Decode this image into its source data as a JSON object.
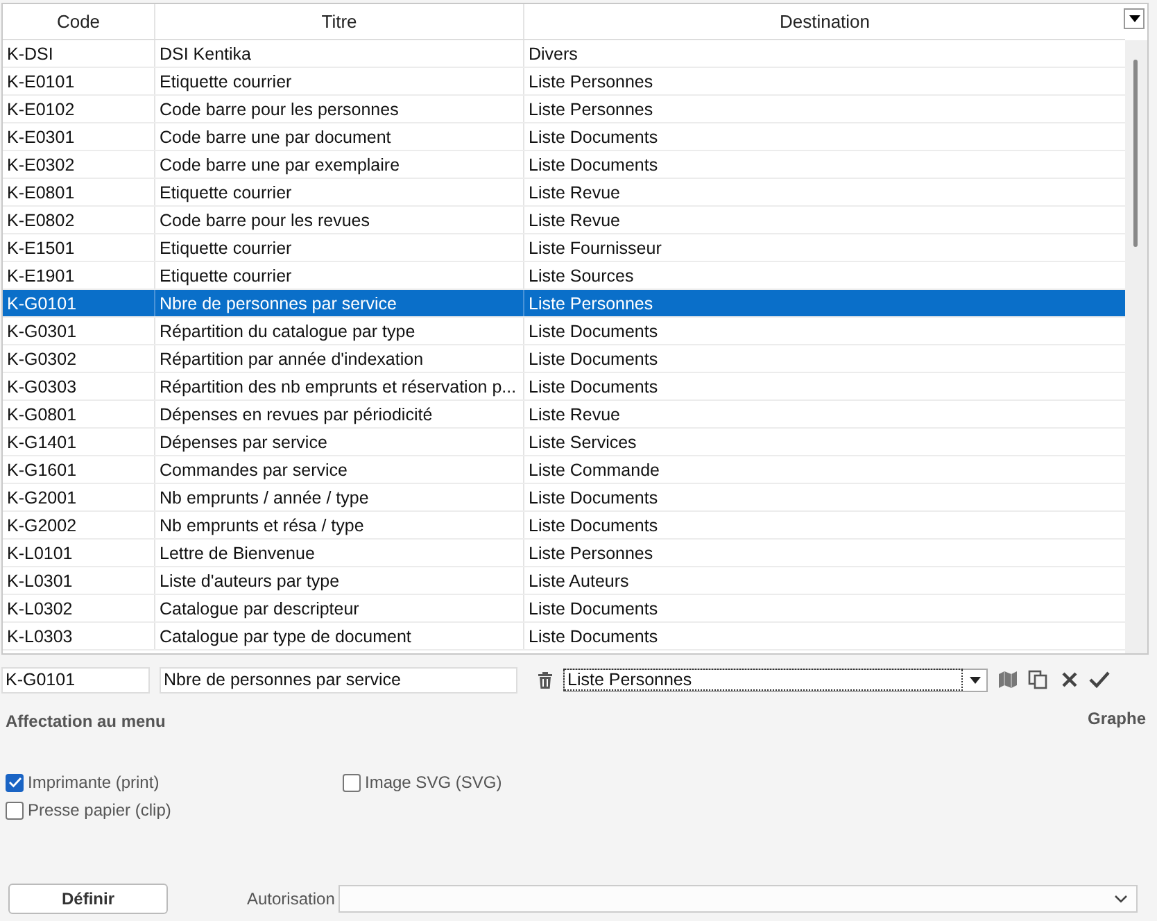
{
  "table": {
    "columns": [
      "Code",
      "Titre",
      "Destination"
    ],
    "rows": [
      {
        "cells": [
          "K-DSI",
          "DSI Kentika",
          "Divers"
        ],
        "selected": false
      },
      {
        "cells": [
          "K-E0101",
          "Etiquette courrier",
          "Liste Personnes"
        ],
        "selected": false
      },
      {
        "cells": [
          "K-E0102",
          "Code barre pour les personnes",
          "Liste Personnes"
        ],
        "selected": false
      },
      {
        "cells": [
          "K-E0301",
          "Code barre une par document",
          "Liste Documents"
        ],
        "selected": false
      },
      {
        "cells": [
          "K-E0302",
          "Code barre une par exemplaire",
          "Liste Documents"
        ],
        "selected": false
      },
      {
        "cells": [
          "K-E0801",
          "Etiquette courrier",
          "Liste Revue"
        ],
        "selected": false
      },
      {
        "cells": [
          "K-E0802",
          "Code barre pour les revues",
          "Liste Revue"
        ],
        "selected": false
      },
      {
        "cells": [
          "K-E1501",
          "Etiquette courrier",
          "Liste Fournisseur"
        ],
        "selected": false
      },
      {
        "cells": [
          "K-E1901",
          "Etiquette courrier",
          "Liste Sources"
        ],
        "selected": false
      },
      {
        "cells": [
          "K-G0101",
          "Nbre de personnes par service",
          "Liste Personnes"
        ],
        "selected": true
      },
      {
        "cells": [
          "K-G0301",
          "Répartition du catalogue par type",
          "Liste Documents"
        ],
        "selected": false
      },
      {
        "cells": [
          "K-G0302",
          "Répartition par année d'indexation",
          "Liste Documents"
        ],
        "selected": false
      },
      {
        "cells": [
          "K-G0303",
          "Répartition des nb emprunts et réservation p...",
          "Liste Documents"
        ],
        "selected": false
      },
      {
        "cells": [
          "K-G0801",
          "Dépenses en revues par périodicité",
          "Liste Revue"
        ],
        "selected": false
      },
      {
        "cells": [
          "K-G1401",
          "Dépenses par service",
          "Liste Services"
        ],
        "selected": false
      },
      {
        "cells": [
          "K-G1601",
          "Commandes par service",
          "Liste Commande"
        ],
        "selected": false
      },
      {
        "cells": [
          "K-G2001",
          "Nb emprunts / année / type",
          "Liste Documents"
        ],
        "selected": false
      },
      {
        "cells": [
          "K-G2002",
          "Nb emprunts et résa / type",
          "Liste Documents"
        ],
        "selected": false
      },
      {
        "cells": [
          "K-L0101",
          "Lettre de Bienvenue",
          "Liste Personnes"
        ],
        "selected": false
      },
      {
        "cells": [
          "K-L0301",
          "Liste d'auteurs par type",
          "Liste Auteurs"
        ],
        "selected": false
      },
      {
        "cells": [
          "K-L0302",
          "Catalogue par descripteur",
          "Liste Documents"
        ],
        "selected": false
      },
      {
        "cells": [
          "K-L0303",
          "Catalogue par type de document",
          "Liste Documents"
        ],
        "selected": false
      }
    ]
  },
  "editor": {
    "code": "K-G0101",
    "title": "Nbre de personnes par service",
    "destination": "Liste Personnes"
  },
  "section_title": "Affectation au menu",
  "graph_label": "Graphe",
  "options": [
    {
      "label": "Imprimante (print)",
      "checked": true
    },
    {
      "label": "Image SVG (SVG)",
      "checked": false
    },
    {
      "label": "Presse papier (clip)",
      "checked": false
    }
  ],
  "define_button": "Définir",
  "authorization": {
    "label": "Autorisation"
  }
}
